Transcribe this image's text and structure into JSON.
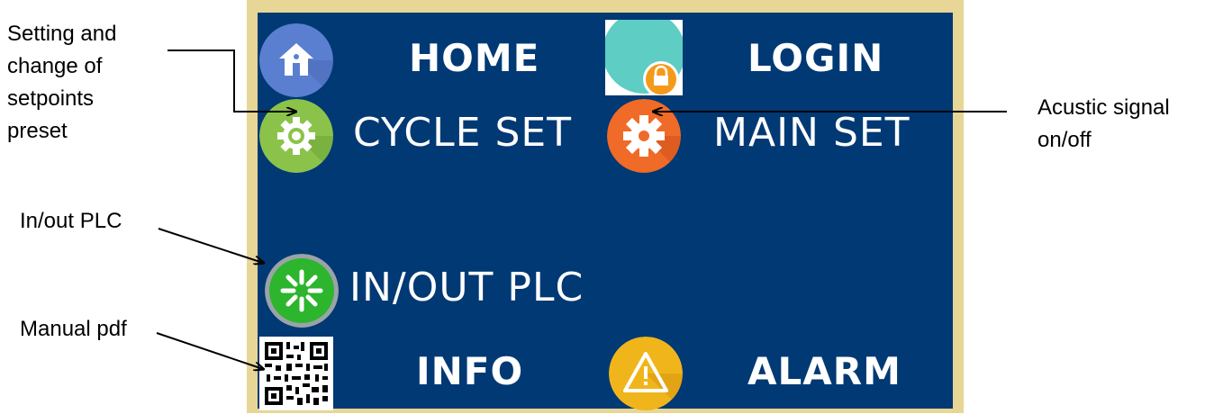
{
  "hmi": {
    "buttons": {
      "home": "HOME",
      "login": "LOGIN",
      "cycle_set": "CYCLE SET",
      "main_set": "MAIN SET",
      "in_out_plc": "IN/OUT PLC",
      "info": "INFO",
      "alarm": "ALARM"
    },
    "icons": {
      "home": "home-icon",
      "login": "lock-icon",
      "cycle_set": "gear-icon",
      "main_set": "gear-icon",
      "in_out_plc": "io-icon",
      "info": "qr-code-icon",
      "alarm": "warning-icon"
    },
    "colors": {
      "screen_bg": "#003974",
      "frame": "#e7d696",
      "home": "#5b7fd0",
      "login": "#5ecdc3",
      "lock_badge": "#f49a1a",
      "cycle_set": "#8bc34a",
      "main_set": "#f06a28",
      "in_out_plc": "#2db52d",
      "alarm": "#f0b51b"
    }
  },
  "annotations": {
    "setpoints": [
      "Setting and",
      "change of",
      "setpoints",
      "preset"
    ],
    "acustic": [
      "Acustic signal",
      "on/off"
    ],
    "inout": [
      "In/out PLC"
    ],
    "manual": [
      "Manual pdf"
    ]
  }
}
